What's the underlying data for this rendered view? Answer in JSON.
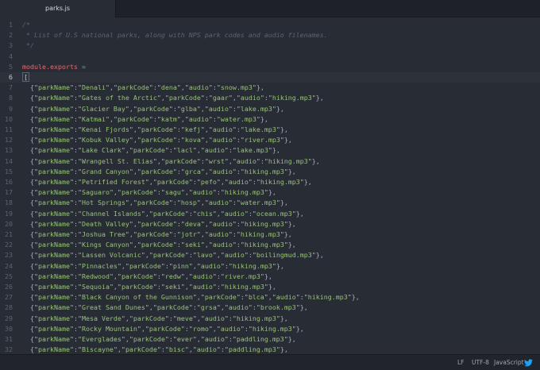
{
  "tab": {
    "title": "parks.js"
  },
  "comment_lines": [
    "/*",
    " * List of U.S national parks, along with NPS park codes and audio filenames.",
    " */"
  ],
  "module_exports": {
    "keyword": "module.exports",
    "op": "="
  },
  "open_bracket": "[",
  "parks": [
    {
      "parkName": "Denali",
      "parkCode": "dena",
      "audio": "snow.mp3"
    },
    {
      "parkName": "Gates of the Arctic",
      "parkCode": "gaar",
      "audio": "hiking.mp3"
    },
    {
      "parkName": "Glacier Bay",
      "parkCode": "glba",
      "audio": "lake.mp3"
    },
    {
      "parkName": "Katmai",
      "parkCode": "katm",
      "audio": "water.mp3"
    },
    {
      "parkName": "Kenai Fjords",
      "parkCode": "kefj",
      "audio": "lake.mp3"
    },
    {
      "parkName": "Kobuk Valley",
      "parkCode": "kova",
      "audio": "river.mp3"
    },
    {
      "parkName": "Lake Clark",
      "parkCode": "lacl",
      "audio": "lake.mp3"
    },
    {
      "parkName": "Wrangell St. Elias",
      "parkCode": "wrst",
      "audio": "hiking.mp3"
    },
    {
      "parkName": "Grand Canyon",
      "parkCode": "grca",
      "audio": "hiking.mp3"
    },
    {
      "parkName": "Petrified Forest",
      "parkCode": "pefo",
      "audio": "hiking.mp3"
    },
    {
      "parkName": "Saguaro",
      "parkCode": "sagu",
      "audio": "hiking.mp3"
    },
    {
      "parkName": "Hot Springs",
      "parkCode": "hosp",
      "audio": "water.mp3"
    },
    {
      "parkName": "Channel Islands",
      "parkCode": "chis",
      "audio": "ocean.mp3"
    },
    {
      "parkName": "Death Valley",
      "parkCode": "deva",
      "audio": "hiking.mp3"
    },
    {
      "parkName": "Joshua Tree",
      "parkCode": "jotr",
      "audio": "hiking.mp3"
    },
    {
      "parkName": "Kings Canyon",
      "parkCode": "seki",
      "audio": "hiking.mp3"
    },
    {
      "parkName": "Lassen Volcanic",
      "parkCode": "lavo",
      "audio": "boilingmud.mp3"
    },
    {
      "parkName": "Pinnacles",
      "parkCode": "pinn",
      "audio": "hiking.mp3"
    },
    {
      "parkName": "Redwood",
      "parkCode": "redw",
      "audio": "river.mp3"
    },
    {
      "parkName": "Sequoia",
      "parkCode": "seki",
      "audio": "hiking.mp3"
    },
    {
      "parkName": "Black Canyon of the Gunnison",
      "parkCode": "blca",
      "audio": "hiking.mp3"
    },
    {
      "parkName": "Great Sand Dunes",
      "parkCode": "grsa",
      "audio": "brook.mp3"
    },
    {
      "parkName": "Mesa Verde",
      "parkCode": "meve",
      "audio": "hiking.mp3"
    },
    {
      "parkName": "Rocky Mountain",
      "parkCode": "romo",
      "audio": "hiking.mp3"
    },
    {
      "parkName": "Everglades",
      "parkCode": "ever",
      "audio": "paddling.mp3"
    },
    {
      "parkName": "Biscayne",
      "parkCode": "bisc",
      "audio": "paddling.mp3"
    }
  ],
  "active_line": 6,
  "status_bar": {
    "line_ending": "LF",
    "encoding": "UTF-8",
    "grammar": "JavaScript",
    "icon": "twitter-bird-icon"
  },
  "colors": {
    "background": "#282c34",
    "comment": "#5c6370",
    "keyword": "#e06c75",
    "string": "#98c379",
    "operator": "#56b6c2",
    "twitter_icon": "#1da1f2"
  }
}
